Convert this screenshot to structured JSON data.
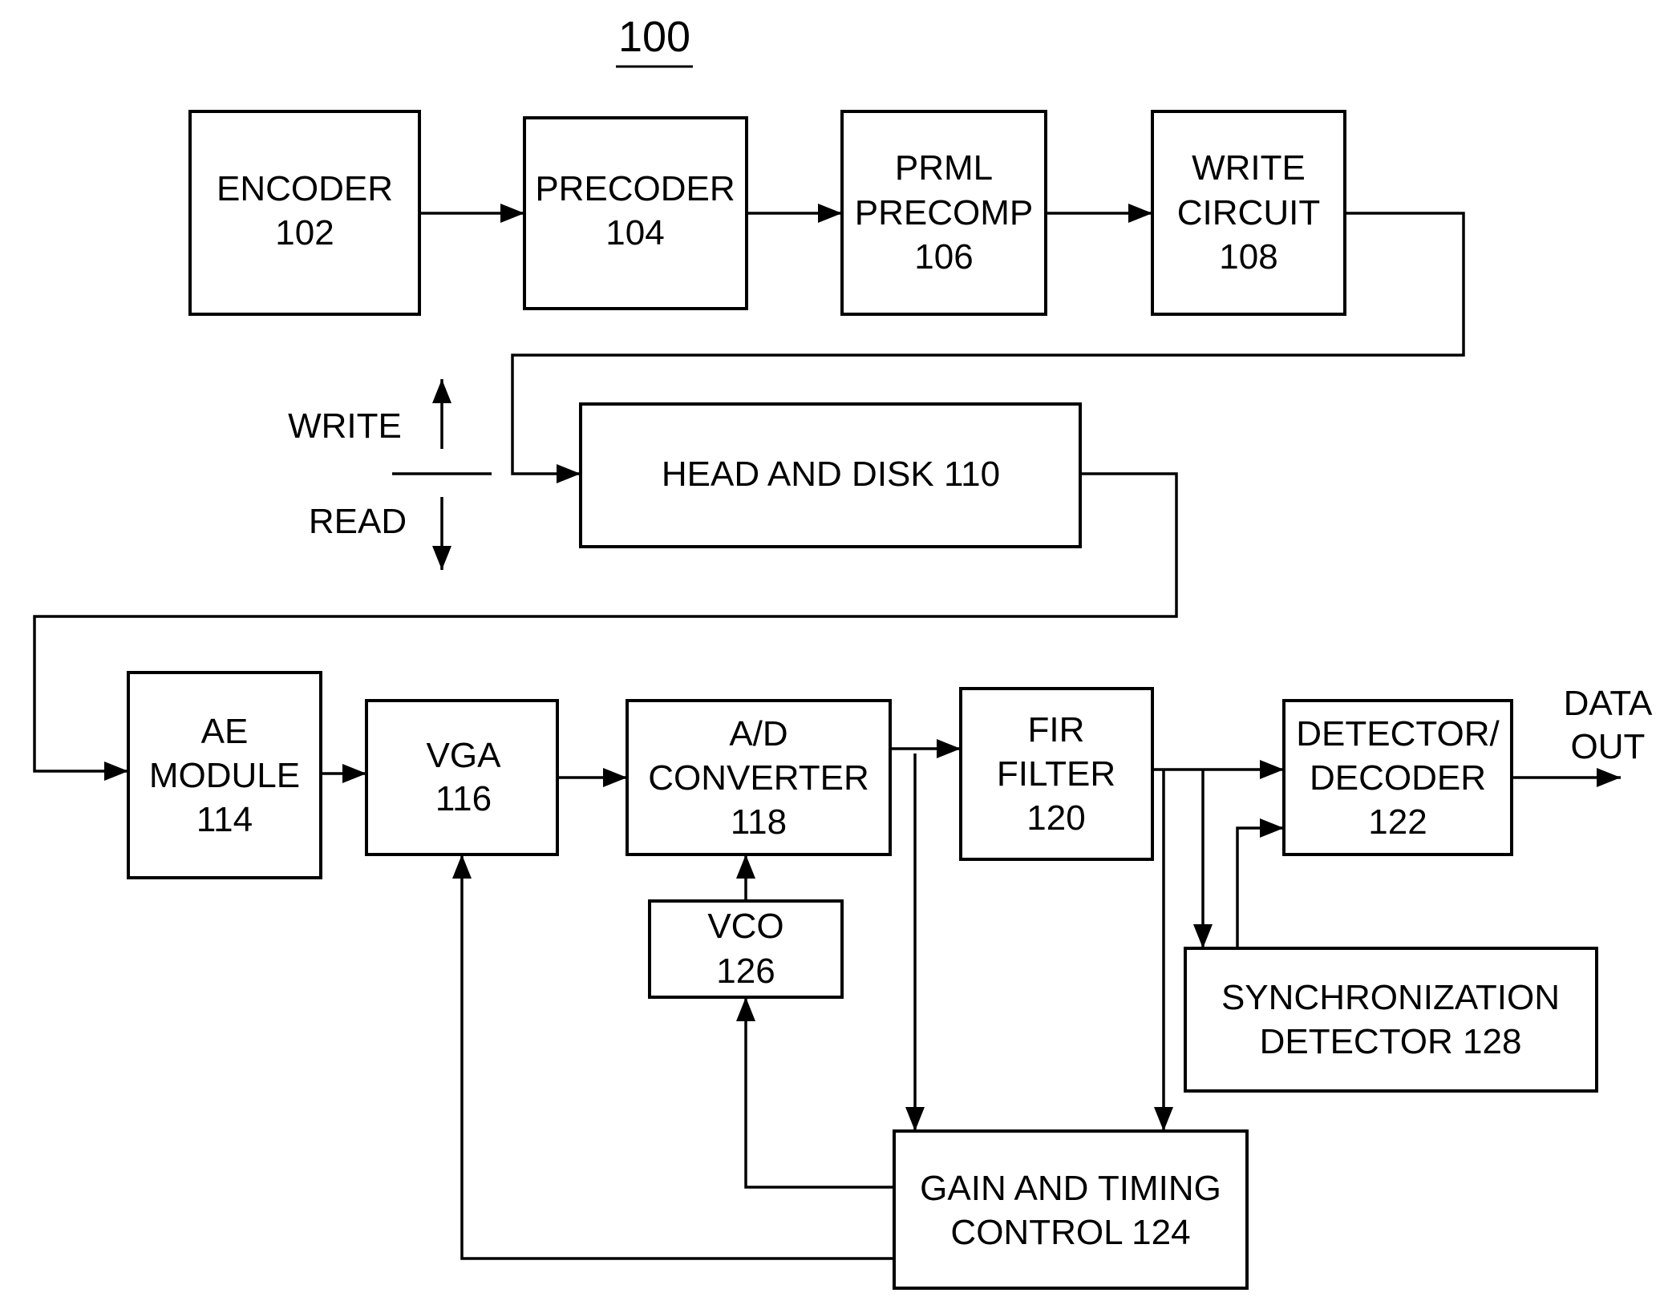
{
  "figure": {
    "reference_number": "100",
    "colors": {
      "ink": "#000000",
      "background": "#ffffff"
    }
  },
  "blocks": {
    "encoder": {
      "lines": [
        "ENCODER",
        "102"
      ]
    },
    "precoder": {
      "lines": [
        "PRECODER",
        "104"
      ]
    },
    "prml_precomp": {
      "lines": [
        "PRML",
        "PRECOMP",
        "106"
      ]
    },
    "write_circuit": {
      "lines": [
        "WRITE",
        "CIRCUIT",
        "108"
      ]
    },
    "head_and_disk": {
      "lines": [
        "HEAD AND DISK 110"
      ]
    },
    "ae_module": {
      "lines": [
        "AE",
        "MODULE",
        "114"
      ]
    },
    "vga": {
      "lines": [
        "VGA",
        "116"
      ]
    },
    "ad_converter": {
      "lines": [
        "A/D",
        "CONVERTER",
        "118"
      ]
    },
    "fir_filter": {
      "lines": [
        "FIR",
        "FILTER",
        "120"
      ]
    },
    "detector_decoder": {
      "lines": [
        "DETECTOR/",
        "DECODER",
        "122"
      ]
    },
    "vco": {
      "lines": [
        "VCO",
        "126"
      ]
    },
    "sync_detector": {
      "lines": [
        "SYNCHRONIZATION",
        "DETECTOR 128"
      ]
    },
    "gain_timing": {
      "lines": [
        "GAIN AND TIMING",
        "CONTROL 124"
      ]
    }
  },
  "annotations": {
    "write_label": "WRITE",
    "read_label": "READ",
    "data_out": [
      "DATA",
      "OUT"
    ]
  }
}
